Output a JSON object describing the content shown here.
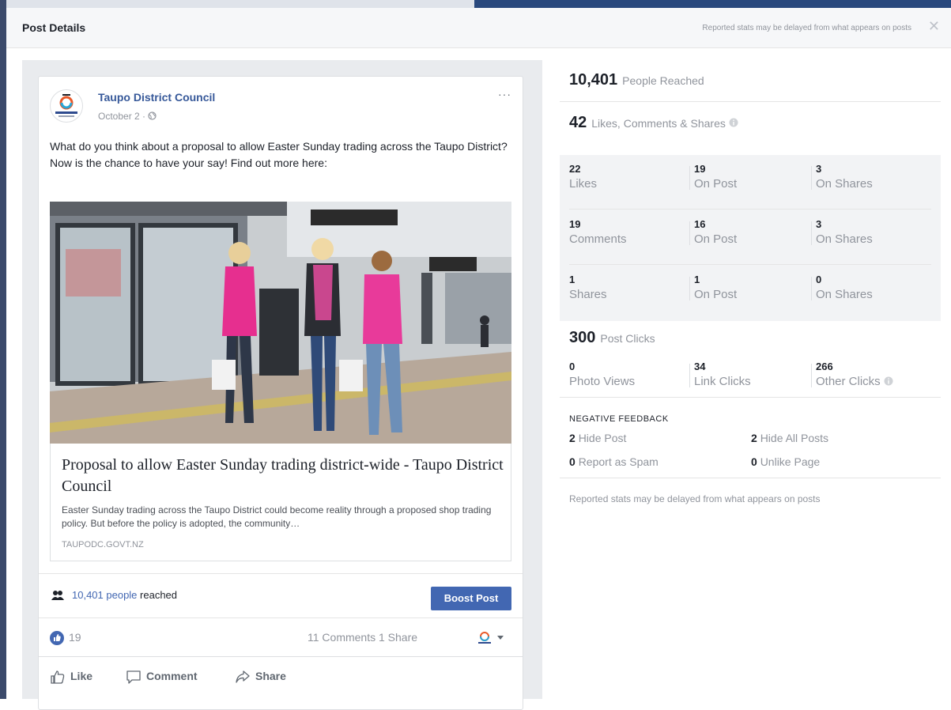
{
  "header": {
    "title": "Post Details",
    "note": "Reported stats may be delayed from what appears on posts",
    "close": "✕"
  },
  "post": {
    "page_name": "Taupo District Council",
    "date": "October 2 · ",
    "more": "···",
    "text": "What do you think about a proposal to allow Easter Sunday trading across the Taupo District? Now is the chance to have your say! Find out more here:",
    "link": {
      "title": "Proposal to allow Easter Sunday trading district-wide - Taupo District Council",
      "description": "Easter Sunday trading across the Taupo District could become reality through a proposed shop trading policy. But before the policy is adopted, the community…",
      "domain": "TAUPODC.GOVT.NZ"
    },
    "reach_count": "10,401 people",
    "reach_suffix": " reached",
    "boost_label": "Boost Post",
    "like_count": "19",
    "comments_shares": "11 Comments  1 Share",
    "actions": {
      "like": "Like",
      "comment": "Comment",
      "share": "Share"
    }
  },
  "stats": {
    "people_reached": {
      "value": "10,401",
      "label": "People Reached"
    },
    "engagement": {
      "value": "42",
      "label": "Likes, Comments & Shares"
    },
    "rows": [
      {
        "total": "22",
        "total_label": "Likes",
        "on_post": "19",
        "on_post_label": "On Post",
        "on_shares": "3",
        "on_shares_label": "On Shares"
      },
      {
        "total": "19",
        "total_label": "Comments",
        "on_post": "16",
        "on_post_label": "On Post",
        "on_shares": "3",
        "on_shares_label": "On Shares"
      },
      {
        "total": "1",
        "total_label": "Shares",
        "on_post": "1",
        "on_post_label": "On Post",
        "on_shares": "0",
        "on_shares_label": "On Shares"
      }
    ],
    "post_clicks": {
      "value": "300",
      "label": "Post Clicks"
    },
    "clicks": [
      {
        "value": "0",
        "label": "Photo Views"
      },
      {
        "value": "34",
        "label": "Link Clicks"
      },
      {
        "value": "266",
        "label": "Other Clicks"
      }
    ],
    "negative": {
      "heading": "NEGATIVE FEEDBACK",
      "items": [
        {
          "value": "2",
          "label": "Hide Post"
        },
        {
          "value": "2",
          "label": "Hide All Posts"
        },
        {
          "value": "0",
          "label": "Report as Spam"
        },
        {
          "value": "0",
          "label": "Unlike Page"
        }
      ]
    },
    "footnote": "Reported stats may be delayed from what appears on posts"
  },
  "colors": {
    "link_blue": "#4267b2",
    "page_name": "#365899",
    "muted": "#90949c"
  },
  "icons": [
    "close-icon",
    "globe-icon",
    "more-icon",
    "people-icon",
    "like-reaction-icon",
    "like-icon",
    "comment-icon",
    "share-icon",
    "info-icon",
    "chevron-down-icon"
  ]
}
